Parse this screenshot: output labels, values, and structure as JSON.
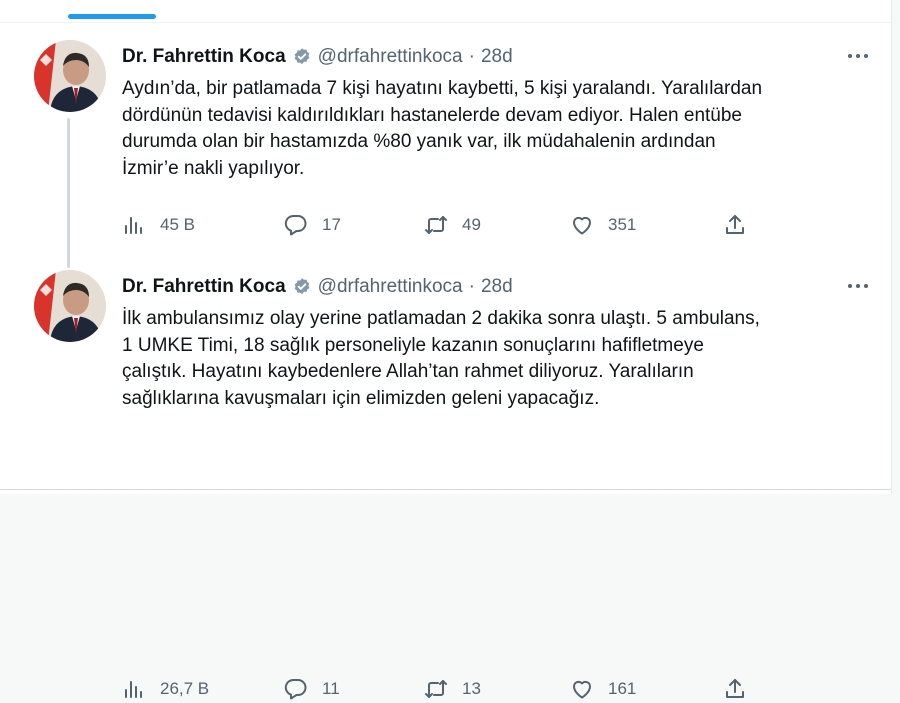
{
  "tweets": [
    {
      "author": "Dr. Fahrettin Koca",
      "handle": "@drfahrettinkoca",
      "separator": "·",
      "time": "28d",
      "text_lines": [
        "Aydın’da, bir patlamada 7 kişi hayatını kaybetti, 5 kişi yaralandı. Yaralılardan",
        "dördünün tedavisi kaldırıldıkları hastanelerde devam ediyor. Halen entübe",
        "durumda olan bir hastamızda %80 yanık var, ilk müdahalenin ardından",
        "İzmir’e nakli yapılıyor."
      ],
      "stats": {
        "views": "45 B",
        "replies": "17",
        "retweets": "49",
        "likes": "351"
      }
    },
    {
      "author": "Dr. Fahrettin Koca",
      "handle": "@drfahrettinkoca",
      "separator": "·",
      "time": "28d",
      "text_lines": [
        "İlk ambulansımız olay yerine patlamadan 2 dakika sonra ulaştı. 5 ambulans,",
        "1 UMKE Timi, 18 sağlık personeliyle kazanın sonuçlarını hafifletmeye",
        "çalıştık. Hayatını kaybedenlere Allah’tan rahmet diliyoruz. Yaralıların",
        "sağlıklarına kavuşmaları için elimizden geleni yapacağız."
      ],
      "stats": {
        "views": "26,7 B",
        "replies": "11",
        "retweets": "13",
        "likes": "161"
      }
    }
  ],
  "icons": {
    "views": "bar-chart-icon",
    "reply": "speech-bubble-icon",
    "retweet": "retweet-icon",
    "like": "heart-icon",
    "share": "share-upload-icon",
    "verified": "verified-badge-icon",
    "more": "more-dots-icon"
  },
  "colors": {
    "accent": "#1d9bf0",
    "verified_badge": "#829aab",
    "text_primary": "#0f1419",
    "text_secondary": "#536471"
  }
}
